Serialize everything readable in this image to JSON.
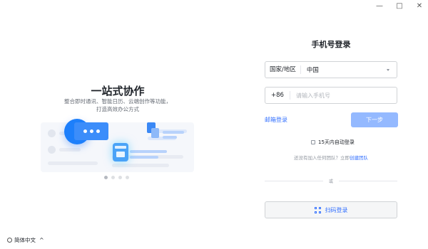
{
  "window": {
    "minimize": "—",
    "maximize": "□",
    "close": "✕"
  },
  "promo": {
    "title": "一站式协作",
    "subtitle_line1": "整合即时通讯、智能日历、云端创作等功能，",
    "subtitle_line2": "打造高效办公方式",
    "carousel_count": 4,
    "carousel_active": 0
  },
  "language": {
    "label": "简体中文"
  },
  "form": {
    "title": "手机号登录",
    "country_label": "国家/地区",
    "country_value": "中国",
    "phone_code": "+86",
    "phone_placeholder": "请输入手机号",
    "email_login": "邮箱登录",
    "next": "下一步",
    "auto_login": "15天内自动登录",
    "no_team_text": "还没有加入任何团队？立即",
    "create_team": "创建团队",
    "divider_text": "或",
    "qr_login": "扫码登录"
  },
  "colors": {
    "accent": "#3370ff",
    "next_disabled": "#94b9ff"
  }
}
